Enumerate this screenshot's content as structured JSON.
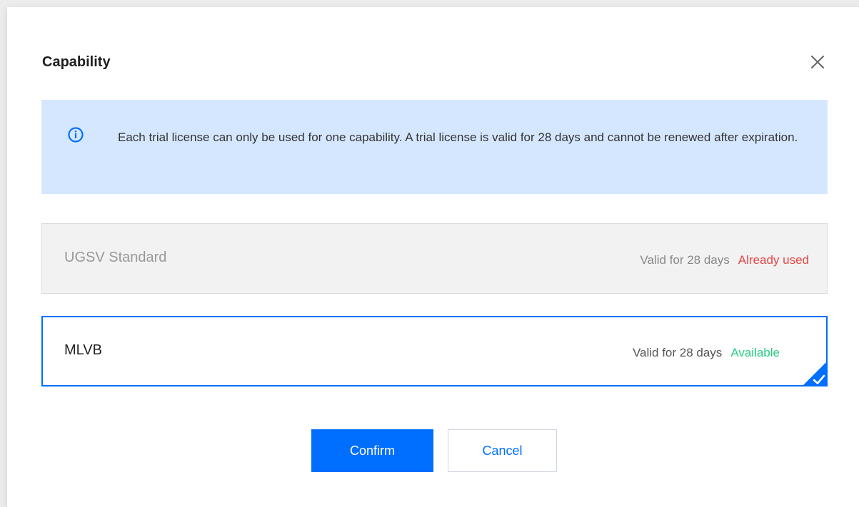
{
  "dialog": {
    "title": "Capability",
    "notice": "Each trial license can only be used for one capability. A trial license is valid for 28 days and cannot be renewed after expiration.",
    "options": [
      {
        "name": "UGSV Standard",
        "validity": "Valid for 28 days",
        "status": "Already used",
        "state": "disabled"
      },
      {
        "name": "MLVB",
        "validity": "Valid for 28 days",
        "status": "Available",
        "state": "selected"
      }
    ],
    "buttons": {
      "confirm": "Confirm",
      "cancel": "Cancel"
    }
  },
  "icons": {
    "close": "close-icon",
    "info": "info-icon",
    "check": "check-icon"
  },
  "colors": {
    "accent": "#006eff",
    "notice_bg": "#d5e7ff",
    "status_used": "#e54545",
    "status_available": "#29cc85"
  }
}
